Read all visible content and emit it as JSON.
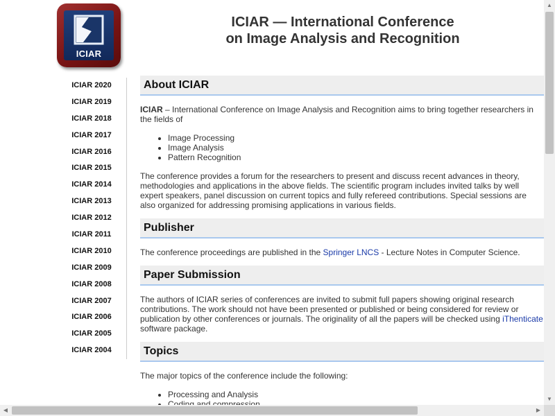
{
  "logo": {
    "text": "ICIAR"
  },
  "header": {
    "title_line1": "ICIAR — International Conference",
    "title_line2": "on Image Analysis and Recognition"
  },
  "sidebar": {
    "items": [
      "ICIAR 2020",
      "ICIAR 2019",
      "ICIAR 2018",
      "ICIAR 2017",
      "ICIAR 2016",
      "ICIAR 2015",
      "ICIAR 2014",
      "ICIAR 2013",
      "ICIAR 2012",
      "ICIAR 2011",
      "ICIAR 2010",
      "ICIAR 2009",
      "ICIAR 2008",
      "ICIAR 2007",
      "ICIAR 2006",
      "ICIAR 2005",
      "ICIAR 2004"
    ]
  },
  "about": {
    "heading": "About ICIAR",
    "intro_bold": "ICIAR",
    "intro_rest": " – International Conference on Image Analysis and Recognition aims to bring together researchers in the fields of",
    "fields": [
      "Image Processing",
      "Image Analysis",
      "Pattern Recognition"
    ],
    "para2": "The conference provides a forum for the researchers to present and discuss recent advances in theory, methodologies and applications in the above fields. The scientific program includes invited talks by well expert speakers, panel discussion on current topics and fully refereed contributions. Special sessions are also organized for addressing promising applications in various fields."
  },
  "publisher": {
    "heading": "Publisher",
    "text_before": "The conference proceedings are published in the ",
    "link": "Springer LNCS",
    "text_after": " - Lecture Notes in Computer Science."
  },
  "submission": {
    "heading": "Paper Submission",
    "text_before": "The authors of ICIAR series of conferences are invited to submit full papers showing original research contributions. The work should not have been presented or published or being considered for review or publication by other conferences or journals. The originality of all the papers will be checked using ",
    "link": "iThenticate",
    "text_after": " software package."
  },
  "topics": {
    "heading": "Topics",
    "intro": "The major topics of the conference include the following:",
    "items": [
      "Processing and Analysis",
      "Coding and compression"
    ]
  },
  "colors": {
    "link": "#1a3aa8",
    "heading_bg": "#eeeeee",
    "heading_rule": "#a9c8ee",
    "logo_frame": "#8b1a1a",
    "logo_fill": "#1a3568"
  }
}
